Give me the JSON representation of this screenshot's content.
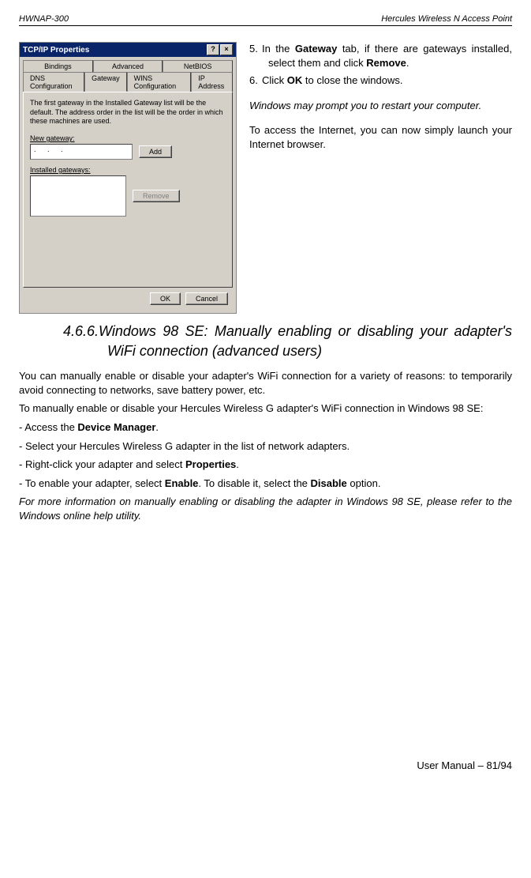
{
  "header": {
    "left": "HWNAP-300",
    "right": "Hercules Wireless N Access Point"
  },
  "dialog": {
    "title": "TCP/IP Properties",
    "help_btn": "?",
    "close_btn": "×",
    "tabs_row1": {
      "bindings": "Bindings",
      "advanced": "Advanced",
      "netbios": "NetBIOS"
    },
    "tabs_row2": {
      "dns": "DNS Configuration",
      "gateway": "Gateway",
      "wins": "WINS Configuration",
      "ip": "IP Address"
    },
    "panel_text": "The first gateway in the Installed Gateway list will be the default. The address order in the list will be the order in which these machines are used.",
    "new_gateway_label": "New gateway:",
    "ip_placeholder": ".   .   .",
    "add_btn": "Add",
    "installed_label": "Installed gateways:",
    "remove_btn": "Remove",
    "ok_btn": "OK",
    "cancel_btn": "Cancel"
  },
  "steps": {
    "s5_num": "5.",
    "s5_a": "In the ",
    "s5_gateway": "Gateway",
    "s5_b": " tab, if there are gateways installed, select them and click ",
    "s5_remove": "Remove",
    "s5_c": ".",
    "s6_num": "6.",
    "s6_a": "Click ",
    "s6_ok": "OK",
    "s6_b": " to close the windows.",
    "note1": "Windows may prompt you to restart your computer.",
    "note2": "To access the Internet, you can now simply launch your Internet browser."
  },
  "section": {
    "num": "4.6.6.",
    "title_a": "Windows 98 SE:  Manually enabling or disabling your adapter's WiFi connection (advanced users)"
  },
  "body": {
    "p1": "You can manually enable or disable your adapter's WiFi connection for a variety of reasons: to temporarily avoid connecting to networks, save battery power, etc.",
    "p2": "To manually enable or disable your Hercules Wireless G adapter's WiFi connection in Windows 98 SE:",
    "b1a": "- Access the ",
    "b1b": "Device Manager",
    "b1c": ".",
    "b2": "- Select your Hercules Wireless G adapter in the list of network adapters.",
    "b3a": "- Right-click your adapter and select ",
    "b3b": "Properties",
    "b3c": ".",
    "b4a": "- To enable your adapter, select ",
    "b4b": "Enable",
    "b4c": ".  To disable it, select the ",
    "b4d": "Disable",
    "b4e": " option.",
    "p3": "For more information on manually enabling or disabling the adapter in Windows 98 SE, please refer to the Windows online help utility."
  },
  "footer": "User Manual – 81/94"
}
